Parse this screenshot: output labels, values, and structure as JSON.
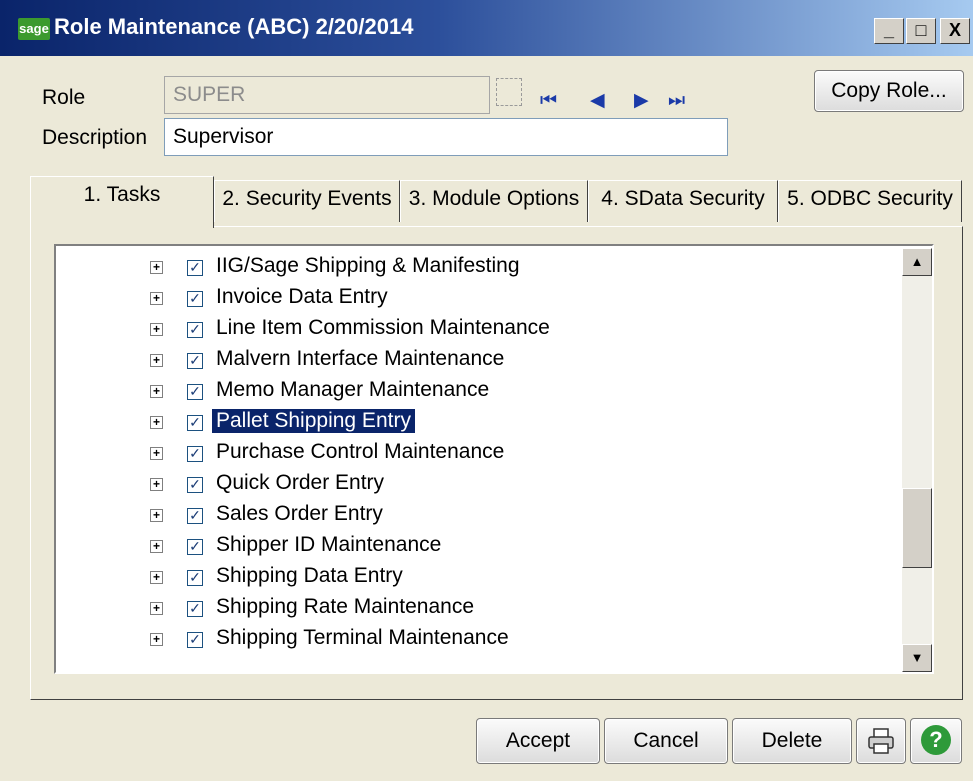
{
  "window": {
    "logo": "sage",
    "title": "Role Maintenance (ABC) 2/20/2014",
    "minimize": "_",
    "maximize": "□",
    "close": "X"
  },
  "header": {
    "role_label": "Role",
    "role_value": "SUPER",
    "description_label": "Description",
    "description_value": "Supervisor",
    "copy_role": "Copy Role..."
  },
  "nav": {
    "first": "⏮",
    "prev": "◀",
    "next": "▶",
    "last": "⏭"
  },
  "tabs": [
    {
      "label": "1. Tasks",
      "active": true
    },
    {
      "label": "2. Security Events",
      "active": false
    },
    {
      "label": "3. Module Options",
      "active": false
    },
    {
      "label": "4. SData Security",
      "active": false
    },
    {
      "label": "5. ODBC Security",
      "active": false
    }
  ],
  "tree": {
    "items": [
      {
        "label": "IIG/Sage Shipping & Manifesting",
        "checked": true
      },
      {
        "label": "Invoice Data Entry",
        "checked": true
      },
      {
        "label": "Line Item Commission Maintenance",
        "checked": true
      },
      {
        "label": "Malvern Interface Maintenance",
        "checked": true
      },
      {
        "label": "Memo Manager Maintenance",
        "checked": true
      },
      {
        "label": "Pallet Shipping Entry",
        "checked": true,
        "selected": true
      },
      {
        "label": "Purchase Control Maintenance",
        "checked": true
      },
      {
        "label": "Quick Order Entry",
        "checked": true
      },
      {
        "label": "Sales Order Entry",
        "checked": true
      },
      {
        "label": "Shipper ID Maintenance",
        "checked": true
      },
      {
        "label": "Shipping Data Entry",
        "checked": true
      },
      {
        "label": "Shipping Rate Maintenance",
        "checked": true
      },
      {
        "label": "Shipping Terminal Maintenance",
        "checked": true
      }
    ]
  },
  "footer": {
    "accept": "Accept",
    "cancel": "Cancel",
    "delete": "Delete",
    "print_icon": "printer-icon",
    "help_icon": "help-icon",
    "help_glyph": "?"
  },
  "colors": {
    "title_start": "#0a246a",
    "selection": "#0a246a",
    "help_green": "#2e9a3a"
  }
}
